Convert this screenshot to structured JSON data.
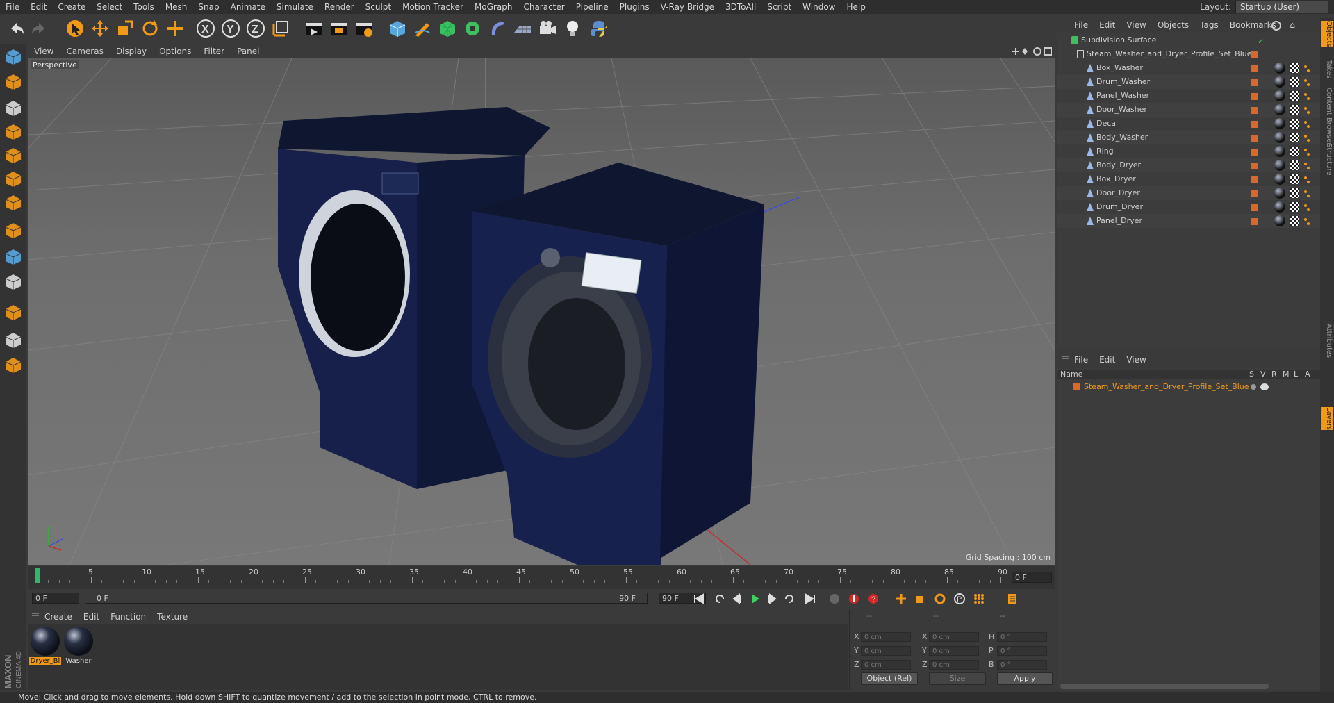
{
  "menubar": {
    "items": [
      "File",
      "Edit",
      "Create",
      "Select",
      "Tools",
      "Mesh",
      "Snap",
      "Animate",
      "Simulate",
      "Render",
      "Sculpt",
      "Motion Tracker",
      "MoGraph",
      "Character",
      "Pipeline",
      "Plugins",
      "V-Ray Bridge",
      "3DToAll",
      "Script",
      "Window",
      "Help"
    ],
    "layout_label": "Layout:",
    "layout_value": "Startup (User)"
  },
  "toolbar": {
    "icons": [
      "undo-icon",
      "redo-icon",
      "select-arrow-icon",
      "move-icon",
      "scale-icon",
      "rotate-icon",
      "add-icon",
      "x-axis-icon",
      "y-axis-icon",
      "z-axis-icon",
      "coordinate-system-icon",
      "render-view-icon",
      "render-region-icon",
      "render-settings-icon",
      "cube-icon",
      "pen-icon",
      "subdivision-icon",
      "array-icon",
      "deformer-icon",
      "floor-icon",
      "camera-icon",
      "light-icon",
      "python-icon"
    ],
    "axis_x": "X",
    "axis_y": "Y",
    "axis_z": "Z"
  },
  "viewport": {
    "menu": [
      "View",
      "Cameras",
      "Display",
      "Options",
      "Filter",
      "Panel"
    ],
    "label": "Perspective",
    "grid_spacing": "Grid Spacing : 100 cm"
  },
  "timeline": {
    "ticks": [
      "0",
      "5",
      "10",
      "15",
      "20",
      "25",
      "30",
      "35",
      "40",
      "45",
      "50",
      "55",
      "60",
      "65",
      "70",
      "75",
      "80",
      "85",
      "90"
    ],
    "current_frame": "0 F",
    "start_field": "0 F",
    "slider_start": "0 F",
    "slider_end": "90 F",
    "end_field": "90 F",
    "max_field": "90 F"
  },
  "materials": {
    "menu": [
      "Create",
      "Edit",
      "Function",
      "Texture"
    ],
    "items": [
      {
        "label": "Dryer_Bl",
        "selected": true
      },
      {
        "label": "Washer",
        "selected": false
      }
    ]
  },
  "coords": {
    "header_dashes": [
      "--",
      "--",
      "--"
    ],
    "rows": [
      {
        "a": "X",
        "av": "0 cm",
        "b": "X",
        "bv": "0 cm",
        "c": "H",
        "cv": "0 °"
      },
      {
        "a": "Y",
        "av": "0 cm",
        "b": "Y",
        "bv": "0 cm",
        "c": "P",
        "cv": "0 °"
      },
      {
        "a": "Z",
        "av": "0 cm",
        "b": "Z",
        "bv": "0 cm",
        "c": "B",
        "cv": "0 °"
      }
    ],
    "mode": "Object (Rel)",
    "size": "Size",
    "apply": "Apply"
  },
  "objects": {
    "menu": [
      "File",
      "Edit",
      "View",
      "Objects",
      "Tags",
      "Bookmarks"
    ],
    "root": "Subdivision Surface",
    "group": "Steam_Washer_and_Dryer_Profile_Set_Blue",
    "children": [
      "Box_Washer",
      "Drum_Washer",
      "Panel_Washer",
      "Door_Washer",
      "Decal",
      "Body_Washer",
      "Ring",
      "Body_Dryer",
      "Box_Dryer",
      "Door_Dryer",
      "Drum_Dryer",
      "Panel_Dryer"
    ]
  },
  "side_tabs": [
    "Objects",
    "Takes",
    "Content Browser",
    "Structure",
    "Attributes",
    "Layers"
  ],
  "layers": {
    "menu": [
      "File",
      "Edit",
      "View"
    ],
    "columns": {
      "name": "Name",
      "s": "S",
      "v": "V",
      "r": "R",
      "m": "M",
      "l": "L",
      "a": "A"
    },
    "items": [
      "Steam_Washer_and_Dryer_Profile_Set_Blue"
    ]
  },
  "status": "Move: Click and drag to move elements. Hold down SHIFT to quantize movement / add to the selection in point mode, CTRL to remove.",
  "brand": "MAXON CINEMA 4D",
  "colors": {
    "accent": "#f19a18",
    "tag": "#d9692a",
    "appliance": "#141c3a"
  }
}
